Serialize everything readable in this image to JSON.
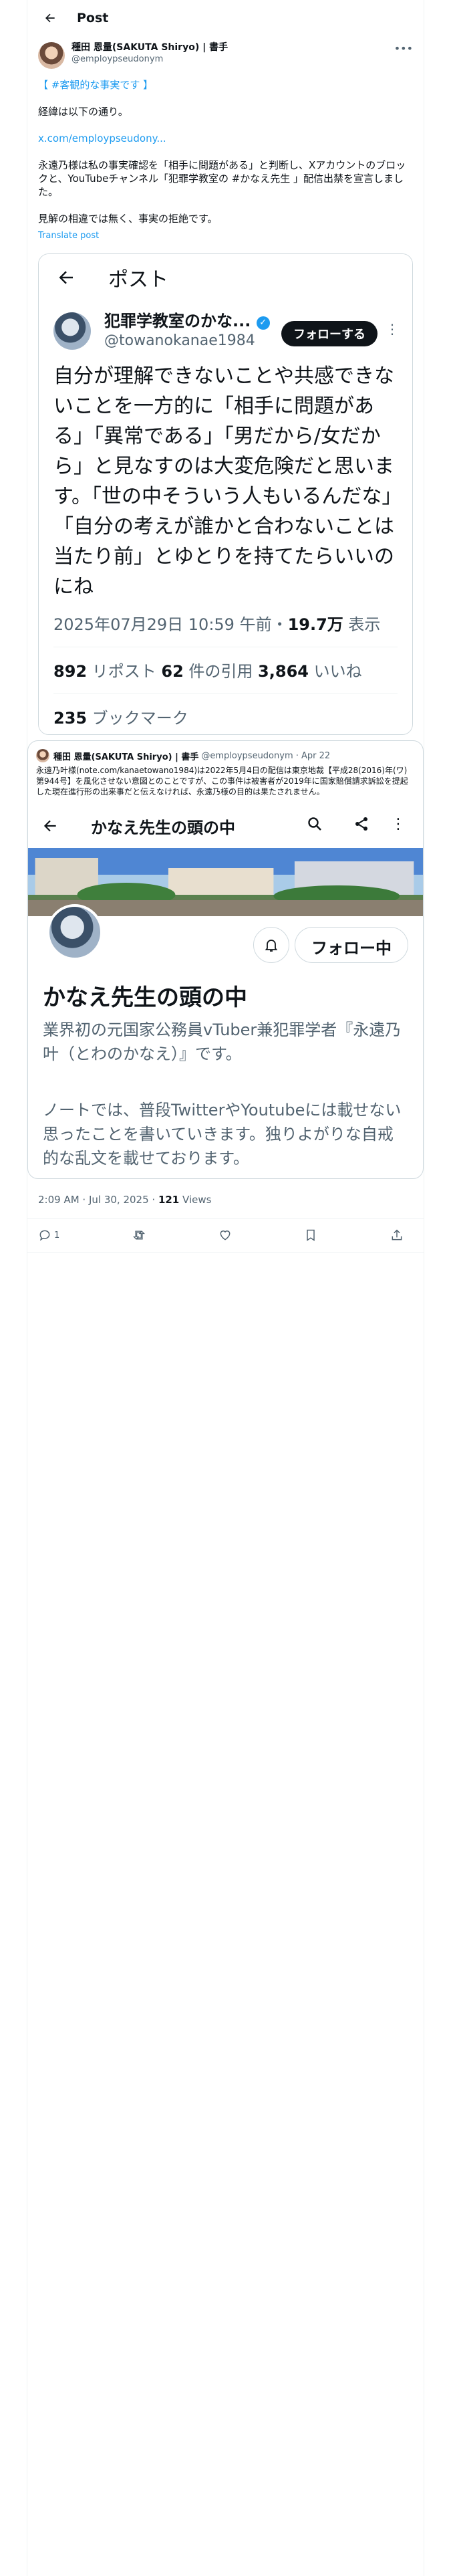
{
  "header": {
    "title": "Post"
  },
  "post": {
    "author_name": "種田 恩量(SAKUTA Shiryo) | 書手",
    "handle": "@employpseudonym",
    "line1": "【 #客観的な事実です 】",
    "line2": "経緯は以下の通り。",
    "link": "x.com/employpseudony...",
    "line3": "永遠乃様は私の事実確認を「相手に問題がある」と判断し、Xアカウントのブロックと、YouTubeチャンネル「犯罪学教室の #かなえ先生 」配信出禁を宣言しました。",
    "line4": "見解の相違では無く、事実の拒絶です。",
    "translate": "Translate post"
  },
  "screenshot": {
    "bar_title": "ポスト",
    "name": "犯罪学教室のかな...",
    "handle": "@towanokanae1984",
    "follow_label": "フォローする",
    "text": "自分が理解できないことや共感できないことを一方的に「相手に問題がある」「異常である」「男だから/女だから」と見なすのは大変危険だと思います。「世の中そういう人もいるんだな」「自分の考えが誰かと合わないことは当たり前」とゆとりを持てたらいいのにね",
    "datetime": "2025年07月29日 10:59 午前・",
    "views_num": "19.7万",
    "views_label": " 表示",
    "reposts_num": "892",
    "reposts_label": " リポスト  ",
    "quotes_num": "62",
    "quotes_label": " 件の引用  ",
    "likes_num": "3,864",
    "likes_label": " いいね",
    "bookmarks_num": "235",
    "bookmarks_label": " ブックマーク"
  },
  "quote": {
    "author_name": "種田 恩量(SAKUTA Shiryo) | 書手",
    "handle": "@employpseudonym · Apr 22",
    "text": "永遠乃叶様(note.com/kanaetowano1984)は2022年5月4日の配信は東京地裁【平成28(2016)年(ワ)第944号】を風化させない意図とのことですが、この事件は被害者が2019年に国家賠償請求訴訟を提起した現在進行形の出来事だと伝えなければ、永遠乃様の目的は果たされません。",
    "inner_title": "かなえ先生の頭の中",
    "following_label": "フォロー中",
    "inner_name": "かなえ先生の頭の中",
    "bio1": "業界初の元国家公務員vTuber兼犯罪学者『永遠乃叶（とわのかなえ）』です。",
    "bio2": "ノートでは、普段TwitterやYoutubeには載せない思ったことを書いていきます。独りよがりな自戒的な乱文を載せております。"
  },
  "footer": {
    "time": "2:09 AM · Jul 30, 2025 · ",
    "views_num": "121",
    "views_label": " Views",
    "reply_count": "1"
  }
}
